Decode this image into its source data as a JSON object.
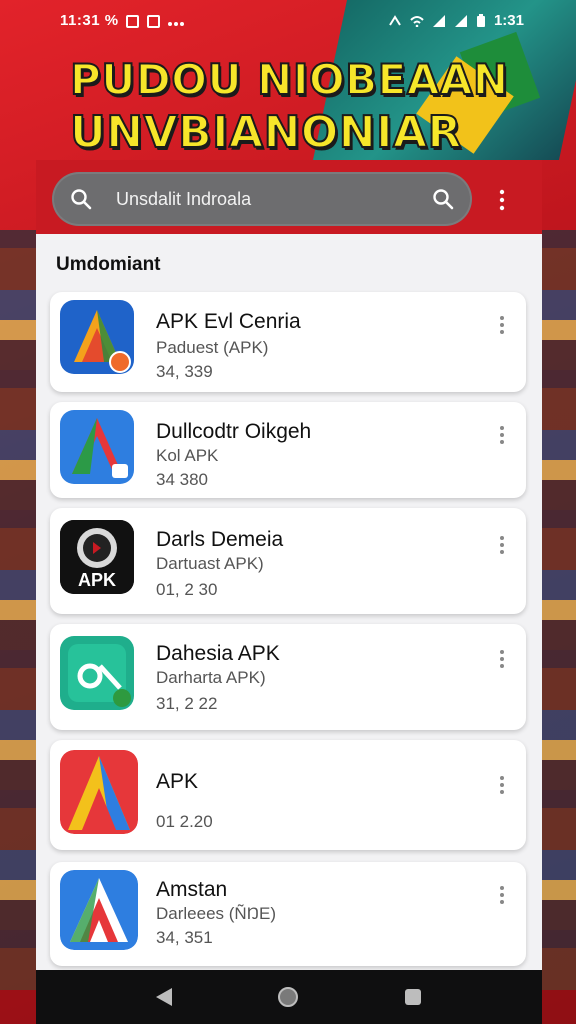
{
  "status_bar": {
    "time": "11:31 %",
    "clock_right": "1:31"
  },
  "headline": {
    "line1": "PUDOU NIOBEAAN",
    "line2": "UNVBIANONIAR"
  },
  "search": {
    "value": "Unsdalit Indroala"
  },
  "section": {
    "title": "Umdomiant"
  },
  "apps": [
    {
      "title": "APK Evl Cenria",
      "subtitle": "Paduest (APK)",
      "meta": "34, 339",
      "icon": "app-icon-a-blue-orange"
    },
    {
      "title": "Dullcodtr Oikgeh",
      "subtitle": "Kol APK",
      "meta": "34 380",
      "icon": "app-icon-a-blue-green"
    },
    {
      "title": "Darls Demeia",
      "subtitle": "Dartuast APK)",
      "meta": "01, 2 30",
      "icon": "app-icon-apk-dark"
    },
    {
      "title": "Dahesia APK",
      "subtitle": "Darharta APK)",
      "meta": "31, 2 22",
      "icon": "app-icon-teal"
    },
    {
      "title": "APK",
      "subtitle": "",
      "meta": "01 2.20",
      "icon": "app-icon-a-multicolor"
    },
    {
      "title": "Amstan",
      "subtitle": "Darleees (ÑŊE)",
      "meta": "34, 351",
      "icon": "app-icon-a-red"
    }
  ],
  "colors": {
    "accent": "#c81a22",
    "headline": "#f7e62a"
  }
}
